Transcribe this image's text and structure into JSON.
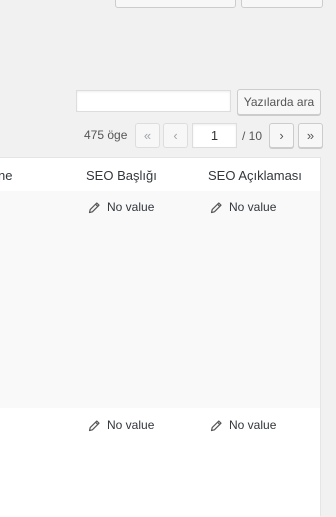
{
  "search": {
    "value": "",
    "placeholder": "",
    "button_label": "Yazılarda ara"
  },
  "pagination": {
    "items_count": "475 öge",
    "first_label": "«",
    "prev_label": "‹",
    "current_page": "1",
    "total_pages": "/ 10",
    "next_label": "›",
    "last_label": "»"
  },
  "table": {
    "columns": [
      "ne",
      "SEO Başlığı",
      "SEO Açıklaması"
    ],
    "rows": [
      {
        "seo_title": "No value",
        "seo_description": "No value"
      },
      {
        "seo_title": "No value",
        "seo_description": "No value"
      }
    ]
  }
}
